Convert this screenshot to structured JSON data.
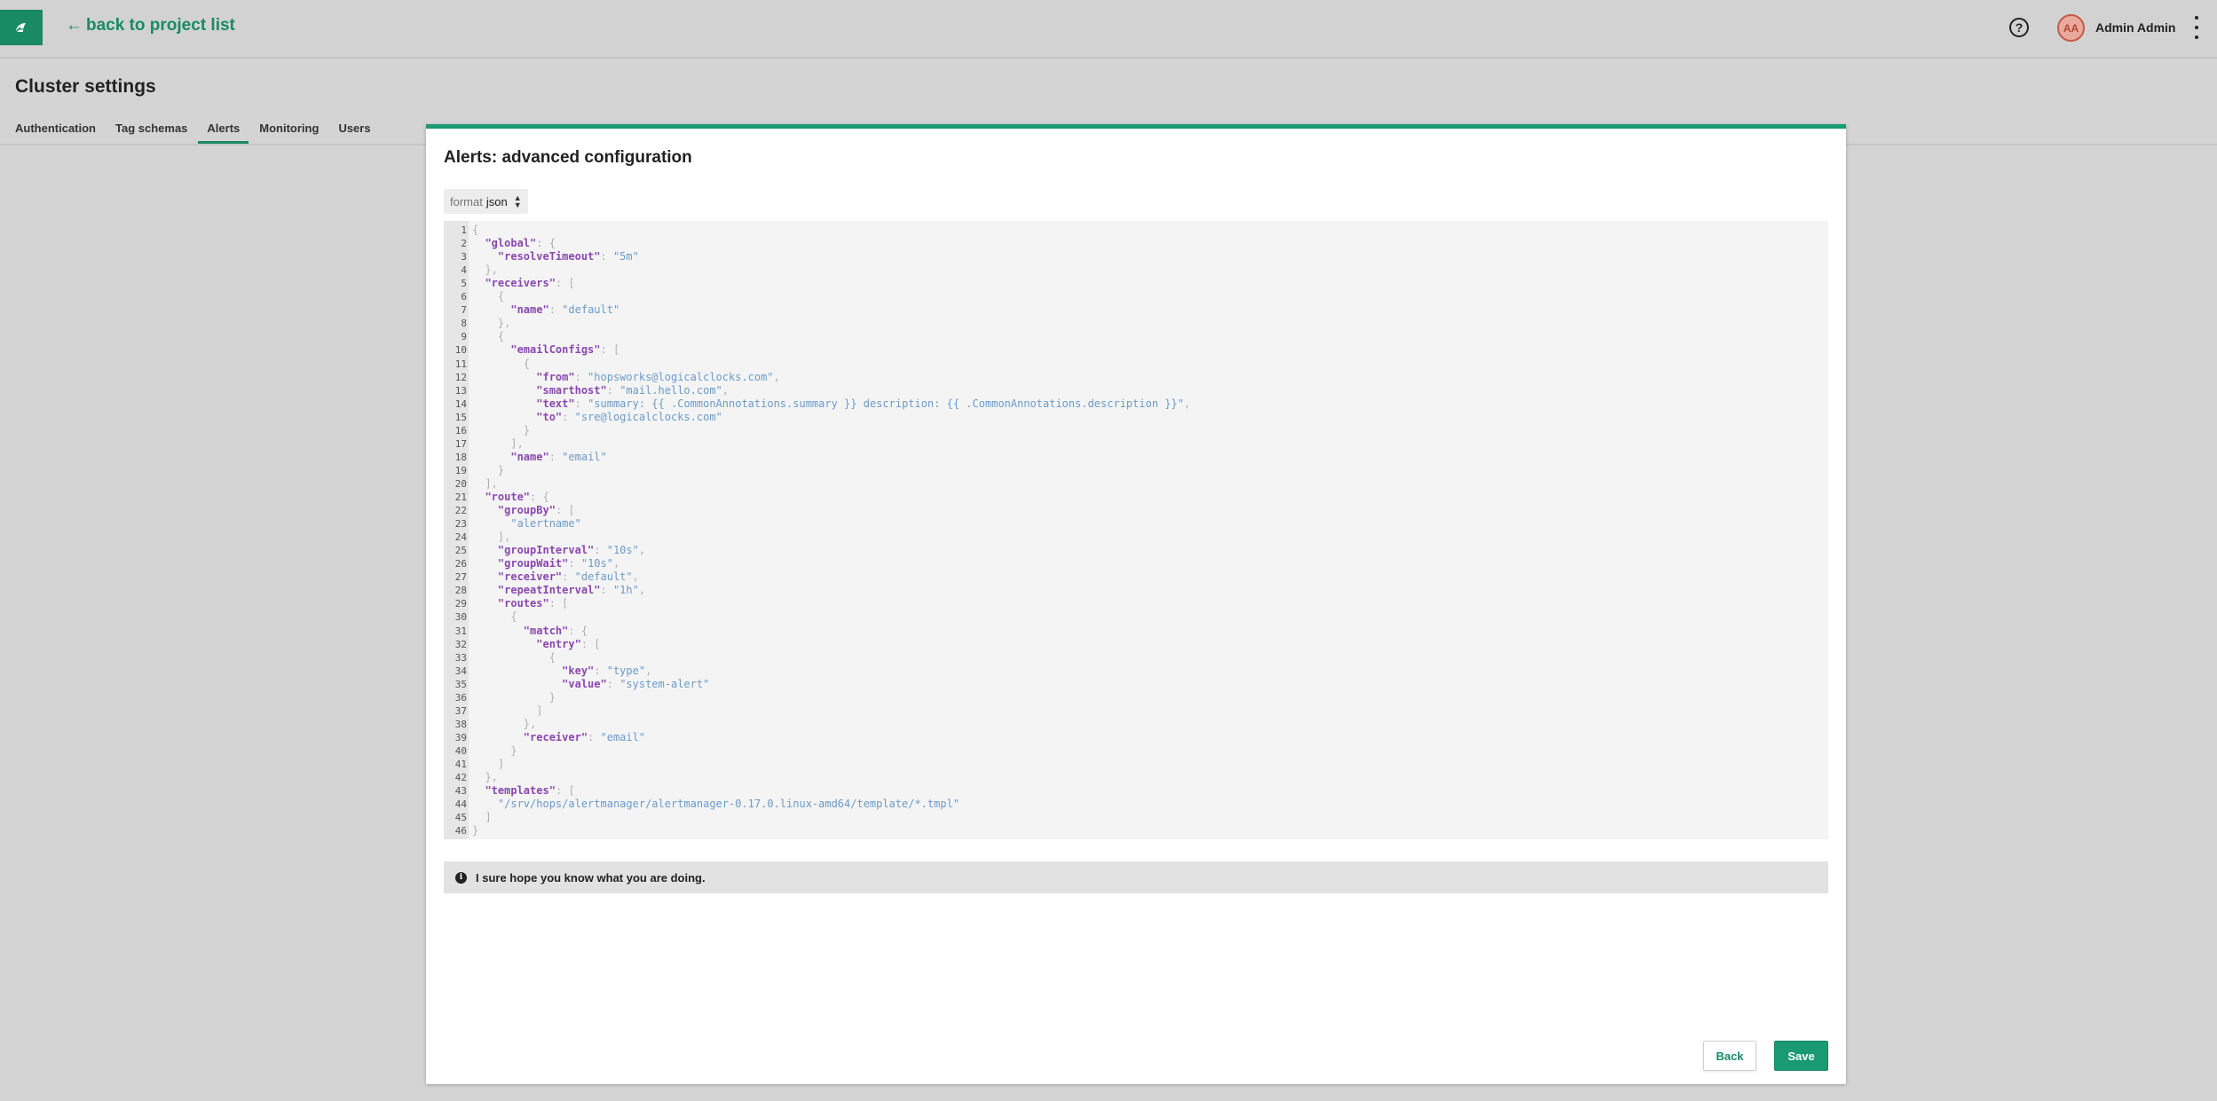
{
  "header": {
    "back_label": "back to project list",
    "help_label": "?",
    "avatar_initials": "AA",
    "user_name": "Admin Admin"
  },
  "page": {
    "title": "Cluster settings",
    "tabs": [
      {
        "label": "Authentication"
      },
      {
        "label": "Tag schemas"
      },
      {
        "label": "Alerts"
      },
      {
        "label": "Monitoring"
      },
      {
        "label": "Users"
      }
    ],
    "active_tab": "Alerts"
  },
  "modal": {
    "title": "Alerts: advanced configuration",
    "format_label": "format",
    "format_value": "json",
    "notice": "I sure hope you know what you are doing.",
    "back_label": "Back",
    "save_label": "Save"
  },
  "editor": {
    "lines": [
      [
        [
          "p",
          "{"
        ]
      ],
      [
        [
          "i",
          "  "
        ],
        [
          "k",
          "\"global\""
        ],
        [
          "p",
          ": {"
        ]
      ],
      [
        [
          "i",
          "    "
        ],
        [
          "k",
          "\"resolveTimeout\""
        ],
        [
          "p",
          ": "
        ],
        [
          "s",
          "\"5m\""
        ]
      ],
      [
        [
          "i",
          "  "
        ],
        [
          "p",
          "},"
        ]
      ],
      [
        [
          "i",
          "  "
        ],
        [
          "k",
          "\"receivers\""
        ],
        [
          "p",
          ": ["
        ]
      ],
      [
        [
          "i",
          "    "
        ],
        [
          "p",
          "{"
        ]
      ],
      [
        [
          "i",
          "      "
        ],
        [
          "k",
          "\"name\""
        ],
        [
          "p",
          ": "
        ],
        [
          "s",
          "\"default\""
        ]
      ],
      [
        [
          "i",
          "    "
        ],
        [
          "p",
          "},"
        ]
      ],
      [
        [
          "i",
          "    "
        ],
        [
          "p",
          "{"
        ]
      ],
      [
        [
          "i",
          "      "
        ],
        [
          "k",
          "\"emailConfigs\""
        ],
        [
          "p",
          ": ["
        ]
      ],
      [
        [
          "i",
          "        "
        ],
        [
          "p",
          "{"
        ]
      ],
      [
        [
          "i",
          "          "
        ],
        [
          "k",
          "\"from\""
        ],
        [
          "p",
          ": "
        ],
        [
          "s",
          "\"hopsworks@logicalclocks.com\""
        ],
        [
          "p",
          ","
        ]
      ],
      [
        [
          "i",
          "          "
        ],
        [
          "k",
          "\"smarthost\""
        ],
        [
          "p",
          ": "
        ],
        [
          "s",
          "\"mail.hello.com\""
        ],
        [
          "p",
          ","
        ]
      ],
      [
        [
          "i",
          "          "
        ],
        [
          "k",
          "\"text\""
        ],
        [
          "p",
          ": "
        ],
        [
          "s",
          "\"summary: {{ .CommonAnnotations.summary }} description: {{ .CommonAnnotations.description }}\""
        ],
        [
          "p",
          ","
        ]
      ],
      [
        [
          "i",
          "          "
        ],
        [
          "k",
          "\"to\""
        ],
        [
          "p",
          ": "
        ],
        [
          "s",
          "\"sre@logicalclocks.com\""
        ]
      ],
      [
        [
          "i",
          "        "
        ],
        [
          "p",
          "}"
        ]
      ],
      [
        [
          "i",
          "      "
        ],
        [
          "p",
          "],"
        ]
      ],
      [
        [
          "i",
          "      "
        ],
        [
          "k",
          "\"name\""
        ],
        [
          "p",
          ": "
        ],
        [
          "s",
          "\"email\""
        ]
      ],
      [
        [
          "i",
          "    "
        ],
        [
          "p",
          "}"
        ]
      ],
      [
        [
          "i",
          "  "
        ],
        [
          "p",
          "],"
        ]
      ],
      [
        [
          "i",
          "  "
        ],
        [
          "k",
          "\"route\""
        ],
        [
          "p",
          ": {"
        ]
      ],
      [
        [
          "i",
          "    "
        ],
        [
          "k",
          "\"groupBy\""
        ],
        [
          "p",
          ": ["
        ]
      ],
      [
        [
          "i",
          "      "
        ],
        [
          "s",
          "\"alertname\""
        ]
      ],
      [
        [
          "i",
          "    "
        ],
        [
          "p",
          "],"
        ]
      ],
      [
        [
          "i",
          "    "
        ],
        [
          "k",
          "\"groupInterval\""
        ],
        [
          "p",
          ": "
        ],
        [
          "s",
          "\"10s\""
        ],
        [
          "p",
          ","
        ]
      ],
      [
        [
          "i",
          "    "
        ],
        [
          "k",
          "\"groupWait\""
        ],
        [
          "p",
          ": "
        ],
        [
          "s",
          "\"10s\""
        ],
        [
          "p",
          ","
        ]
      ],
      [
        [
          "i",
          "    "
        ],
        [
          "k",
          "\"receiver\""
        ],
        [
          "p",
          ": "
        ],
        [
          "s",
          "\"default\""
        ],
        [
          "p",
          ","
        ]
      ],
      [
        [
          "i",
          "    "
        ],
        [
          "k",
          "\"repeatInterval\""
        ],
        [
          "p",
          ": "
        ],
        [
          "s",
          "\"1h\""
        ],
        [
          "p",
          ","
        ]
      ],
      [
        [
          "i",
          "    "
        ],
        [
          "k",
          "\"routes\""
        ],
        [
          "p",
          ": ["
        ]
      ],
      [
        [
          "i",
          "      "
        ],
        [
          "p",
          "{"
        ]
      ],
      [
        [
          "i",
          "        "
        ],
        [
          "k",
          "\"match\""
        ],
        [
          "p",
          ": {"
        ]
      ],
      [
        [
          "i",
          "          "
        ],
        [
          "k",
          "\"entry\""
        ],
        [
          "p",
          ": ["
        ]
      ],
      [
        [
          "i",
          "            "
        ],
        [
          "p",
          "{"
        ]
      ],
      [
        [
          "i",
          "              "
        ],
        [
          "k",
          "\"key\""
        ],
        [
          "p",
          ": "
        ],
        [
          "s",
          "\"type\""
        ],
        [
          "p",
          ","
        ]
      ],
      [
        [
          "i",
          "              "
        ],
        [
          "k",
          "\"value\""
        ],
        [
          "p",
          ": "
        ],
        [
          "s",
          "\"system-alert\""
        ]
      ],
      [
        [
          "i",
          "            "
        ],
        [
          "p",
          "}"
        ]
      ],
      [
        [
          "i",
          "          "
        ],
        [
          "p",
          "]"
        ]
      ],
      [
        [
          "i",
          "        "
        ],
        [
          "p",
          "},"
        ]
      ],
      [
        [
          "i",
          "        "
        ],
        [
          "k",
          "\"receiver\""
        ],
        [
          "p",
          ": "
        ],
        [
          "s",
          "\"email\""
        ]
      ],
      [
        [
          "i",
          "      "
        ],
        [
          "p",
          "}"
        ]
      ],
      [
        [
          "i",
          "    "
        ],
        [
          "p",
          "]"
        ]
      ],
      [
        [
          "i",
          "  "
        ],
        [
          "p",
          "},"
        ]
      ],
      [
        [
          "i",
          "  "
        ],
        [
          "k",
          "\"templates\""
        ],
        [
          "p",
          ": ["
        ]
      ],
      [
        [
          "i",
          "    "
        ],
        [
          "s",
          "\"/srv/hops/alertmanager/alertmanager-0.17.0.linux-amd64/template/*.tmpl\""
        ]
      ],
      [
        [
          "i",
          "  "
        ],
        [
          "p",
          "]"
        ]
      ],
      [
        [
          "p",
          "}"
        ]
      ]
    ]
  },
  "colors": {
    "accent": "#1a8a64",
    "json_key": "#8a47b0",
    "json_string": "#6b9ac7",
    "json_punct": "#b0b0b0"
  }
}
